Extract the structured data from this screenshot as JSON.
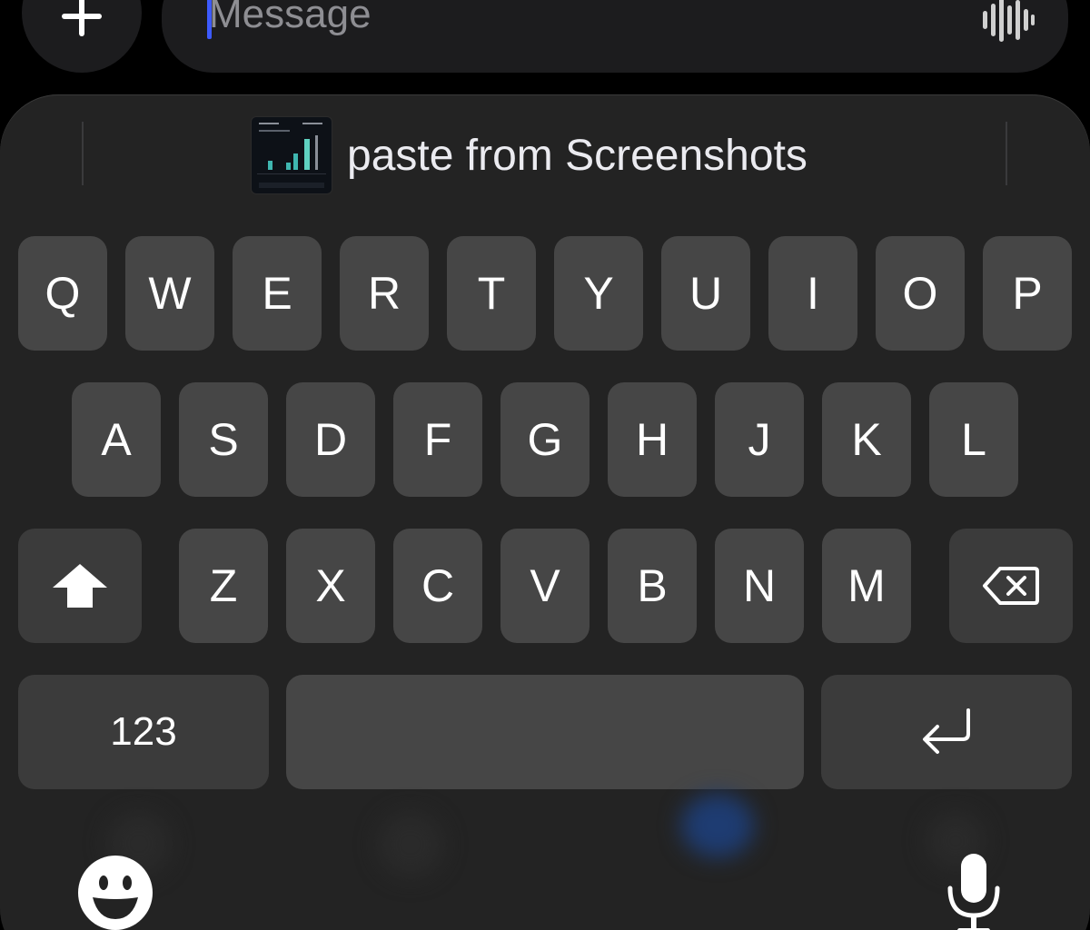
{
  "composer": {
    "add_icon": "plus-icon",
    "message_placeholder": "Message",
    "voice_icon": "waveform-icon",
    "caret_color": "#3d5afe"
  },
  "suggestion": {
    "label": "paste from Screenshots",
    "thumbnail_icon": "screenshot-thumbnail"
  },
  "keyboard": {
    "row1": [
      "Q",
      "W",
      "E",
      "R",
      "T",
      "Y",
      "U",
      "I",
      "O",
      "P"
    ],
    "row2": [
      "A",
      "S",
      "D",
      "F",
      "G",
      "H",
      "J",
      "K",
      "L"
    ],
    "row3": [
      "Z",
      "X",
      "C",
      "V",
      "B",
      "N",
      "M"
    ],
    "shift_icon": "shift-icon",
    "delete_icon": "backspace-icon",
    "numbers_label": "123",
    "return_icon": "return-icon",
    "emoji_icon": "emoji-icon",
    "dictation_icon": "microphone-icon"
  },
  "colors": {
    "background": "#000000",
    "keyboard_bg": "#232323",
    "key_bg": "#464646",
    "key_text": "#ffffff"
  }
}
